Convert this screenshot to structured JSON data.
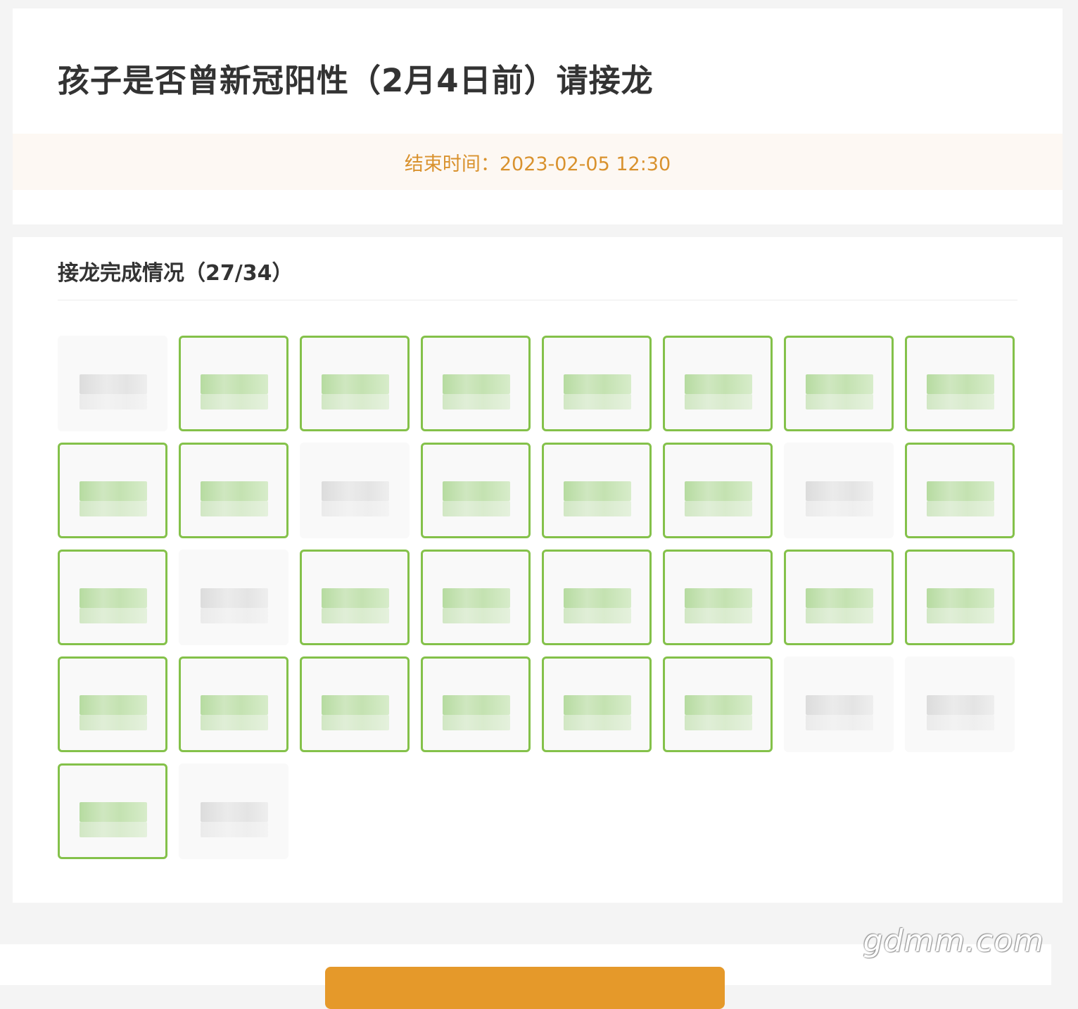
{
  "header": {
    "title": "孩子是否曾新冠阳性（2月4日前）请接龙",
    "deadline": "结束时间：2023-02-05 12:30"
  },
  "progress": {
    "title": "接龙完成情况（27/34）",
    "completed": 27,
    "total": 34,
    "tiles": [
      {
        "done": false
      },
      {
        "done": true
      },
      {
        "done": true
      },
      {
        "done": true
      },
      {
        "done": true
      },
      {
        "done": true
      },
      {
        "done": true
      },
      {
        "done": true
      },
      {
        "done": true
      },
      {
        "done": true
      },
      {
        "done": false
      },
      {
        "done": true
      },
      {
        "done": true
      },
      {
        "done": true
      },
      {
        "done": false
      },
      {
        "done": true
      },
      {
        "done": true
      },
      {
        "done": false
      },
      {
        "done": true
      },
      {
        "done": true
      },
      {
        "done": true
      },
      {
        "done": true
      },
      {
        "done": true
      },
      {
        "done": true
      },
      {
        "done": true
      },
      {
        "done": true
      },
      {
        "done": true
      },
      {
        "done": true
      },
      {
        "done": true
      },
      {
        "done": true
      },
      {
        "done": false
      },
      {
        "done": false
      },
      {
        "done": true
      },
      {
        "done": false
      }
    ]
  },
  "footer": {
    "button_label": ""
  },
  "watermark": "gdmm.com",
  "colors": {
    "accent": "#e5992a",
    "deadline_text": "#d9922e",
    "done_border": "#84c14a"
  }
}
